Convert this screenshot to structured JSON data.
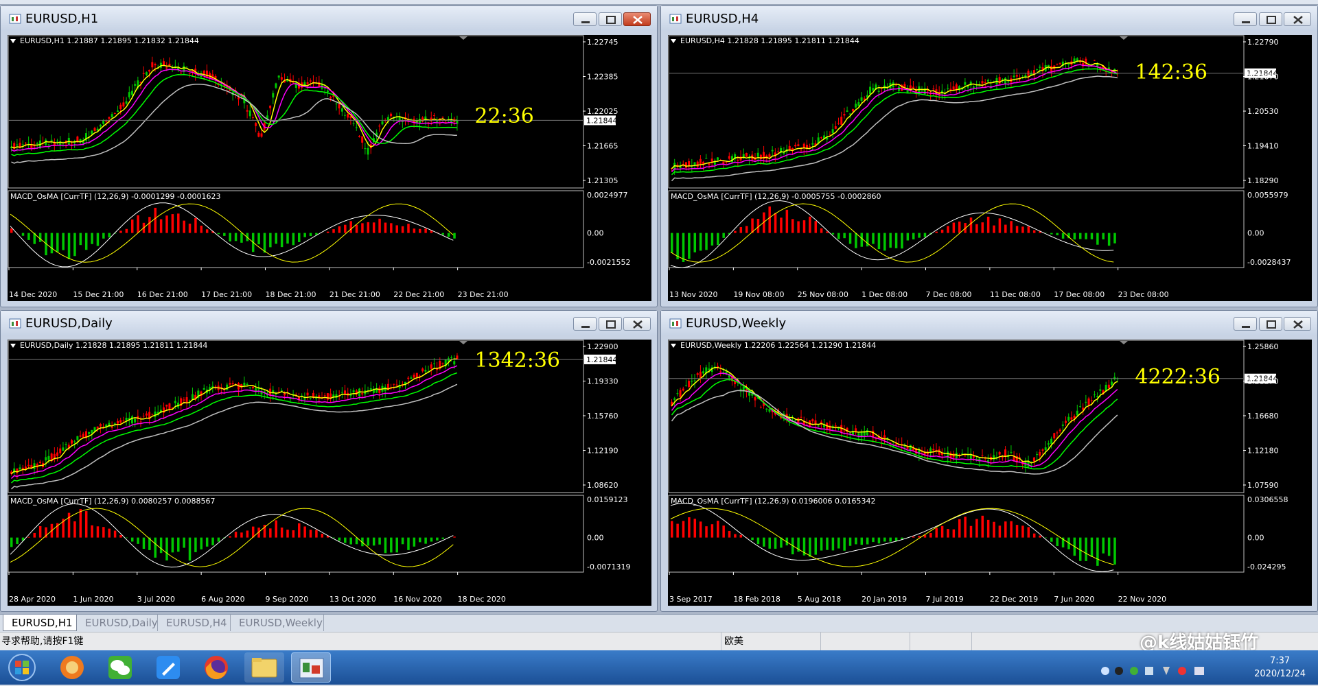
{
  "windows": [
    {
      "key": "h1",
      "title": "EURUSD,H1",
      "header": "EURUSD,H1  1.21887 1.21895 1.21832 1.21844",
      "timer": "22:36",
      "price_axis": [
        "1.22745",
        "1.22385",
        "1.22025",
        "1.21665",
        "1.21305"
      ],
      "current_price": "1.21844",
      "osc_header": "MACD_OsMA [CurrTF] (12,26,9) -0.0001299 -0.0001623",
      "osc_axis": [
        "0.0024977",
        "0.00",
        "-0.0021552"
      ],
      "dates": [
        "14 Dec 2020",
        "15 Dec 21:00",
        "16 Dec 21:00",
        "17 Dec 21:00",
        "18 Dec 21:00",
        "21 Dec 21:00",
        "22 Dec 21:00",
        "23 Dec 21:00"
      ],
      "close_style": "red"
    },
    {
      "key": "h4",
      "title": "EURUSD,H4",
      "header": "EURUSD,H4  1.21828 1.21895 1.21811 1.21844",
      "timer": "142:36",
      "price_axis": [
        "1.22790",
        "1.21670",
        "1.20530",
        "1.19410",
        "1.18290"
      ],
      "current_price": "1.21844",
      "osc_header": "MACD_OsMA [CurrTF] (12,26,9) -0.0005755 -0.0002860",
      "osc_axis": [
        "0.0055979",
        "0.00",
        "-0.0028437"
      ],
      "dates": [
        "13 Nov 2020",
        "19 Nov 08:00",
        "25 Nov 08:00",
        "1 Dec 08:00",
        "7 Dec 08:00",
        "11 Dec 08:00",
        "17 Dec 08:00",
        "23 Dec 08:00"
      ],
      "close_style": "plain"
    },
    {
      "key": "d1",
      "title": "EURUSD,Daily",
      "header": "EURUSD,Daily  1.21828 1.21895 1.21811 1.21844",
      "timer": "1342:36",
      "price_axis": [
        "1.22900",
        "1.19330",
        "1.15760",
        "1.12190",
        "1.08620"
      ],
      "current_price": "1.21844",
      "osc_header": "MACD_OsMA [CurrTF] (12,26,9) 0.0080257 0.0088567",
      "osc_axis": [
        "0.0159123",
        "0.00",
        "-0.0071319"
      ],
      "dates": [
        "28 Apr 2020",
        "1 Jun 2020",
        "3 Jul 2020",
        "6 Aug 2020",
        "9 Sep 2020",
        "13 Oct 2020",
        "16 Nov 2020",
        "18 Dec 2020"
      ],
      "close_style": "plain"
    },
    {
      "key": "w1",
      "title": "EURUSD,Weekly",
      "header": "EURUSD,Weekly  1.22206 1.22564 1.21290 1.21844",
      "timer": "4222:36",
      "price_axis": [
        "1.25860",
        "1.21270",
        "1.16680",
        "1.12180",
        "1.07590"
      ],
      "current_price": "1.21844",
      "osc_header": "MACD_OsMA [CurrTF] (12,26,9) 0.0196006 0.0165342",
      "osc_axis": [
        "0.0306558",
        "0.00",
        "-0.024295"
      ],
      "dates": [
        "3 Sep 2017",
        "18 Feb 2018",
        "5 Aug 2018",
        "20 Jan 2019",
        "7 Jul 2019",
        "22 Dec 2019",
        "7 Jun 2020",
        "22 Nov 2020"
      ],
      "close_style": "plain"
    }
  ],
  "tabs": [
    "EURUSD,H1",
    "EURUSD,Daily",
    "EURUSD,H4",
    "EURUSD,Weekly"
  ],
  "status": {
    "help": "寻求帮助,请按F1键",
    "profile": "欧美",
    "watermark": "@k线姑姑钰竹"
  },
  "clock": {
    "time": "7:37",
    "date": "2020/12/24"
  },
  "colors": {
    "bg": "#000000",
    "bull": "#00c800",
    "bear": "#ff0000",
    "ma_fast": "#ffff00",
    "ma_mid": "#ff00ff",
    "ma_slow": "#00ff00",
    "ma_long": "#c0c0c0",
    "timer": "#ffff00",
    "axis_text": "#ffffff"
  },
  "icons": [
    "start-orb-icon",
    "firefox-alt-icon",
    "wechat-icon",
    "pen-icon",
    "firefox-icon",
    "folder-icon",
    "metatrader-icon"
  ]
}
